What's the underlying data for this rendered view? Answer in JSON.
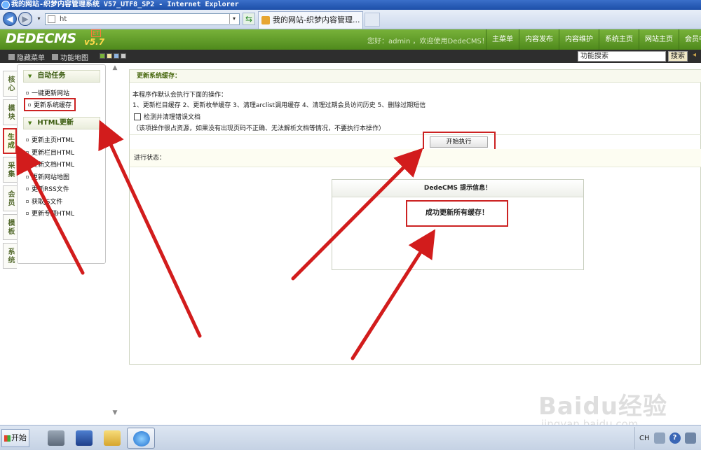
{
  "browser": {
    "window_title": "我的网站-织梦内容管理系统 V57_UTF8_SP2 - Internet Explorer",
    "address": "ht",
    "tab_title": "我的网站-织梦内容管理..."
  },
  "header": {
    "logo": "DEDECMS",
    "version": "v5.7",
    "version_badge": "ET",
    "greeting": "您好：admin ，欢迎使用DedeCMS！",
    "nav": [
      "主菜单",
      "内容发布",
      "内容维护",
      "系统主页",
      "网站主页",
      "会员中"
    ]
  },
  "toolbar": {
    "hide_menu": "隐藏菜单",
    "site_map": "功能地图",
    "search_value": "功能搜索",
    "search_button": "搜索",
    "swatch_colors": [
      "#7ab33a",
      "#f2e3a0",
      "#8fb4e0",
      "#c9c9c9"
    ]
  },
  "vtabs": [
    "核心",
    "模块",
    "生成",
    "采集",
    "会员",
    "模板",
    "系统"
  ],
  "sidebar": {
    "section1_title": "自动任务",
    "section1_items": [
      "一键更新网站",
      "更新系统缓存"
    ],
    "section2_title": "HTML更新",
    "section2_items": [
      "更新主页HTML",
      "更新栏目HTML",
      "更新文档HTML",
      "更新网站地图",
      "更新RSS文件",
      "获取JS文件",
      "更新专题HTML"
    ]
  },
  "main": {
    "title": "更新系统缓存：",
    "intro": "本程序作默认会执行下面的操作：",
    "ops": "1、更新栏目缓存 2、更新枚举缓存 3、清理arclist调用缓存 4、清理过期会员访问历史 5、删除过期短信",
    "checkbox_label": "检测并清理错误文档",
    "note": "（该项操作很占资源，如果没有出现页码不正确、无法解析文档等情况，不要执行本操作）",
    "run_button": "开始执行",
    "status_label": "进行状态：",
    "msg_title": "DedeCMS 提示信息！",
    "msg_body": "成功更新所有缓存！"
  },
  "watermark": {
    "brand": "Baidu经验",
    "url": "jingyan.baidu.com"
  },
  "taskbar": {
    "start": "开始",
    "lang": "CH"
  },
  "colors": {
    "header_green": "#5f9b28",
    "highlight_red": "#cc2222",
    "toolbar_dark": "#2e2e2e"
  }
}
